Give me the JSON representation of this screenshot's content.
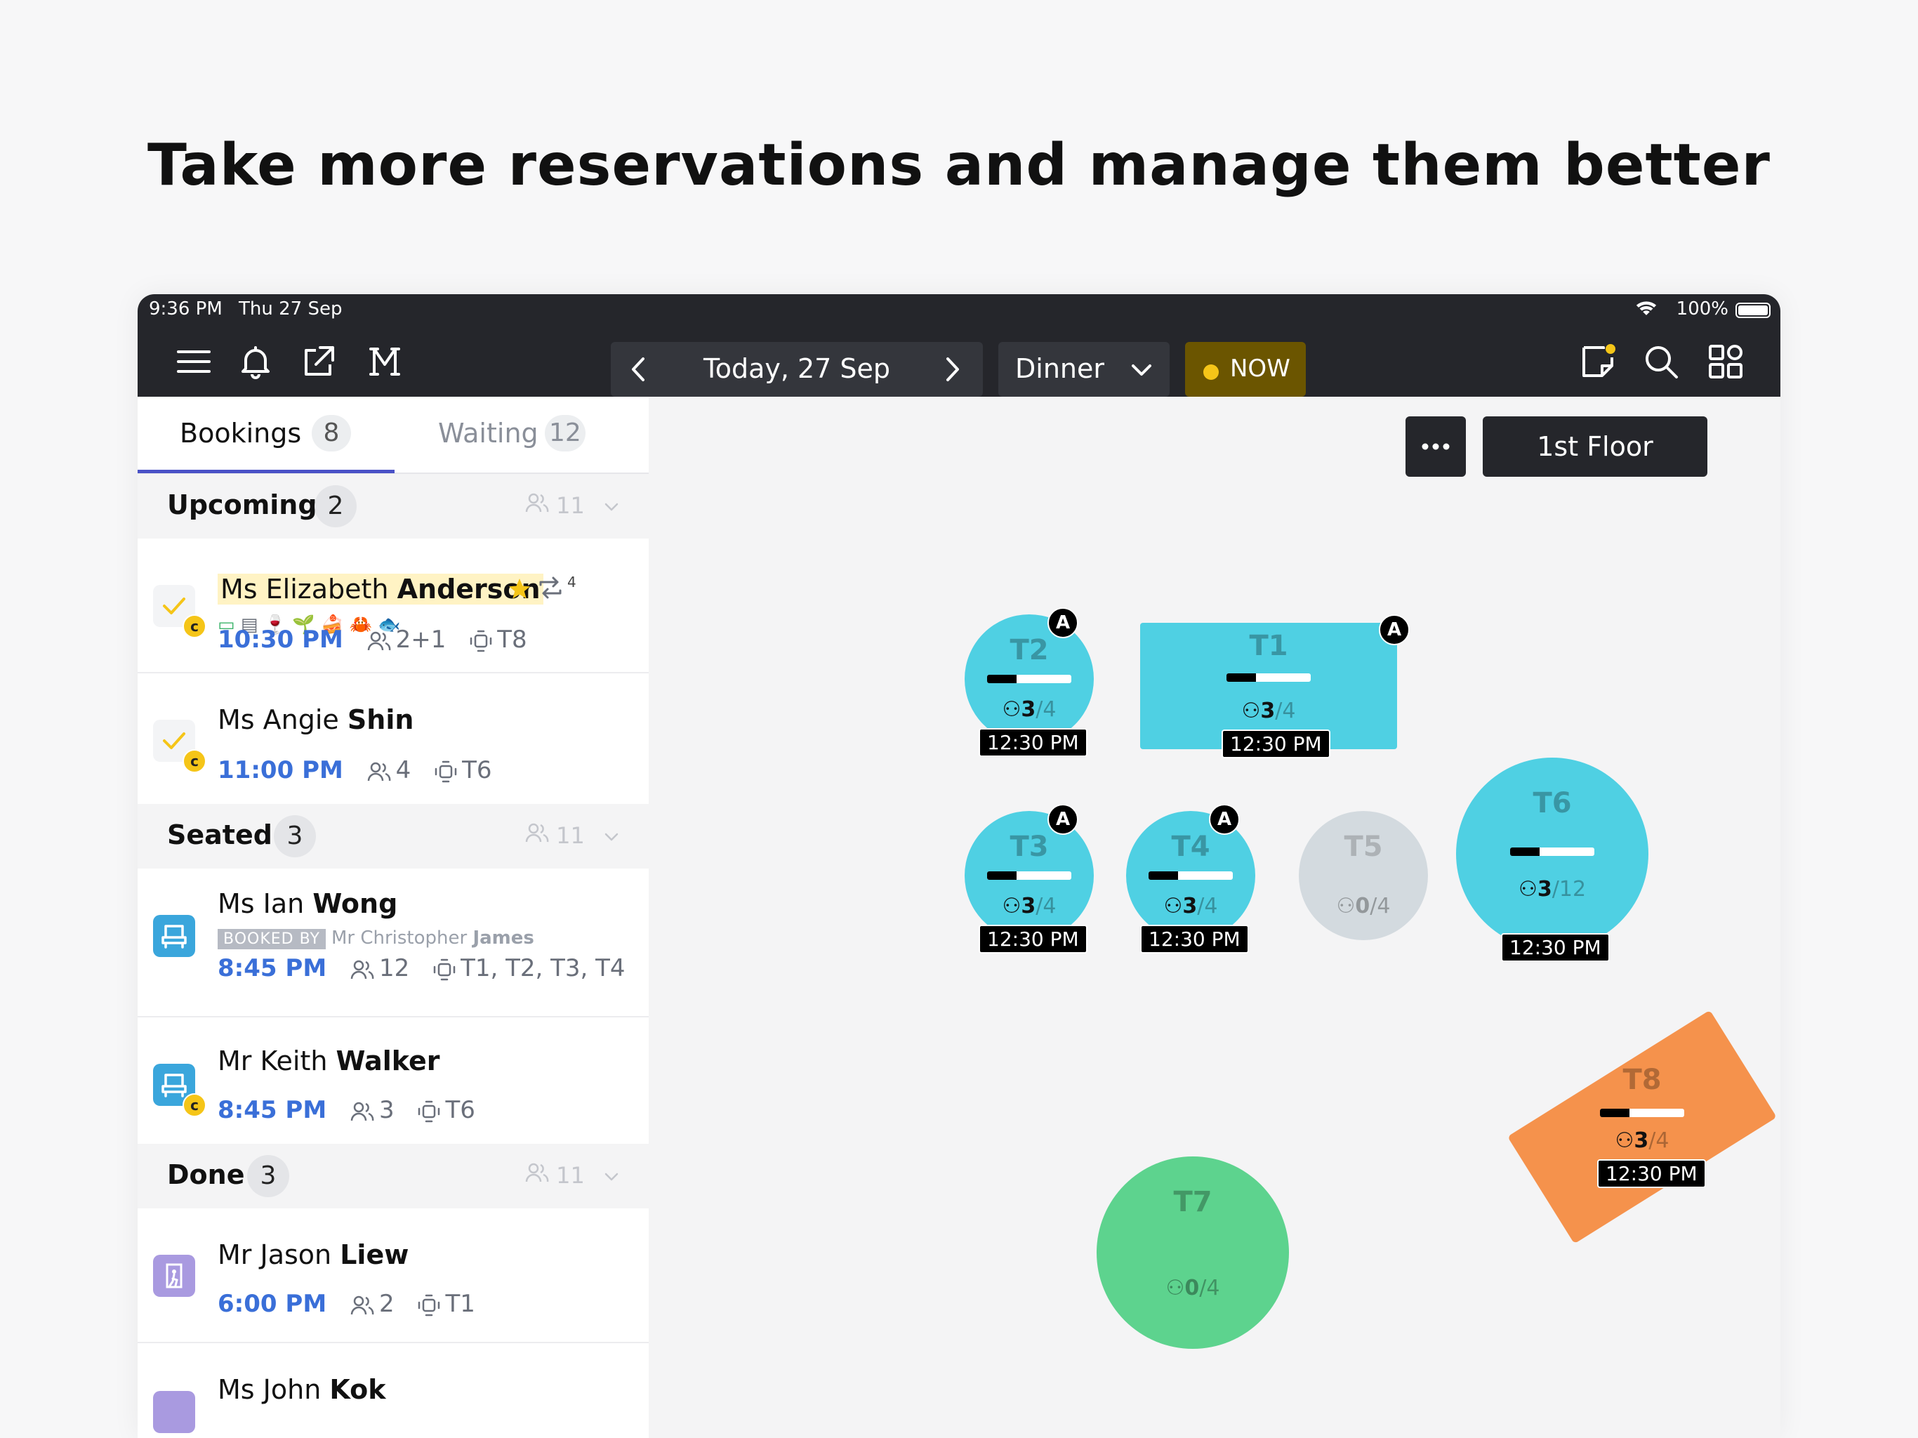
{
  "headline": "Take more reservations and manage them better",
  "statusbar": {
    "time": "9:36 PM",
    "date": "Thu 27 Sep",
    "battery": "100%"
  },
  "toolbar": {
    "date_label": "Today, 27 Sep",
    "meal_label": "Dinner",
    "now_label": "NOW",
    "icons": [
      "menu-icon",
      "bell-icon",
      "external-link-icon",
      "m-logo-icon",
      "notes-icon",
      "search-icon",
      "grid-icon"
    ]
  },
  "tabs": [
    {
      "label": "Bookings",
      "count": "8",
      "active": true
    },
    {
      "label": "Waiting",
      "count": "12",
      "active": false
    }
  ],
  "sections": {
    "upcoming": {
      "title": "Upcoming",
      "count": "2",
      "guests": "11"
    },
    "seated": {
      "title": "Seated",
      "count": "3",
      "guests": "11"
    },
    "done": {
      "title": "Done",
      "count": "3",
      "guests": "11"
    }
  },
  "bookings": [
    {
      "salutation": "Ms Elizabeth",
      "surname": "Anderson",
      "time": "10:30 PM",
      "guests": "2+1",
      "table": "T8",
      "repeat_count": "4"
    },
    {
      "salutation": "Ms Angie",
      "surname": "Shin",
      "time": "11:00 PM",
      "guests": "4",
      "table": "T6"
    },
    {
      "salutation": "Ms Ian",
      "surname": "Wong",
      "booked_by_tag": "BOOKED BY",
      "booked_by": "Mr Christopher",
      "booked_by_surname": "James",
      "time": "8:45 PM",
      "guests": "12",
      "table": "T1, T2, T3, T4"
    },
    {
      "salutation": "Mr Keith",
      "surname": "Walker",
      "time": "8:45 PM",
      "guests": "3",
      "table": "T6"
    },
    {
      "salutation": "Mr Jason",
      "surname": "Liew",
      "time": "6:00 PM",
      "guests": "2",
      "table": "T1"
    },
    {
      "salutation": "Ms John",
      "surname": "Kok"
    }
  ],
  "floor": {
    "floor_name": "1st Floor",
    "colors": {
      "occupied": "#4fd0e3",
      "empty": "#d3dadf",
      "available": "#5dd38e",
      "alert": "#f5924c"
    },
    "tables": [
      {
        "name": "T2",
        "seated": "3",
        "total": "/4",
        "time": "12:30 PM",
        "badge": "A",
        "progress": 0.35
      },
      {
        "name": "T1",
        "seated": "3",
        "total": "/4",
        "time": "12:30 PM",
        "badge": "A",
        "progress": 0.35
      },
      {
        "name": "T3",
        "seated": "3",
        "total": "/4",
        "time": "12:30 PM",
        "badge": "A",
        "progress": 0.35
      },
      {
        "name": "T4",
        "seated": "3",
        "total": "/4",
        "time": "12:30 PM",
        "badge": "A",
        "progress": 0.35
      },
      {
        "name": "T5",
        "seated": "0",
        "total": "/4"
      },
      {
        "name": "T6",
        "seated": "3",
        "total": "/12",
        "time": "12:30 PM",
        "progress": 0.35
      },
      {
        "name": "T8",
        "seated": "3",
        "total": "/4",
        "time": "12:30 PM",
        "progress": 0.35
      },
      {
        "name": "T7",
        "seated": "0",
        "total": "/4"
      }
    ]
  }
}
